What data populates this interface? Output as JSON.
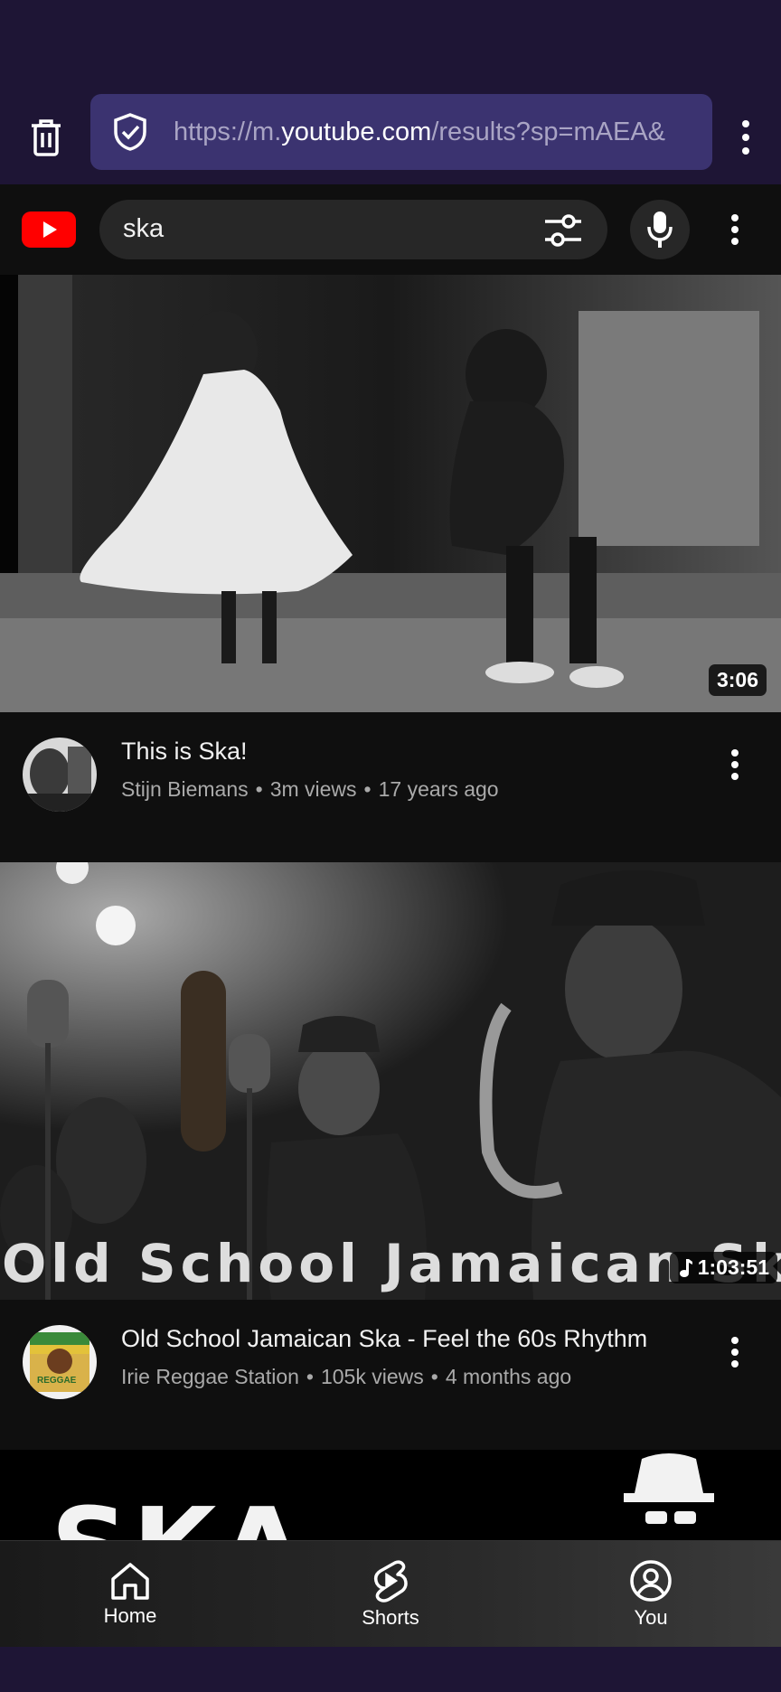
{
  "browser": {
    "url_prefix": "https://m.",
    "url_domain": "youtube.com",
    "url_rest": "/results?sp=mAEA&"
  },
  "header": {
    "search_query": "ska"
  },
  "videos": [
    {
      "title": "This is Ska!",
      "channel": "Stijn Biemans",
      "views": "3m views",
      "age": "17 years ago",
      "duration": "3:06"
    },
    {
      "title": "Old School Jamaican Ska - Feel the 60s Rhythm",
      "channel": "Irie Reggae Station",
      "views": "105k views",
      "age": "4 months ago",
      "duration": "1:03:51",
      "overlay_text": "Old School Jamaican Ska",
      "avatar_text": "REGGAE"
    },
    {
      "overlay_text": "SKA"
    }
  ],
  "bottom_nav": {
    "home": "Home",
    "shorts": "Shorts",
    "you": "You"
  },
  "colors": {
    "browser_bg": "#1e1535",
    "url_box": "#3b3370",
    "yt_red": "#ff0000",
    "page_bg": "#0f0f0f"
  }
}
